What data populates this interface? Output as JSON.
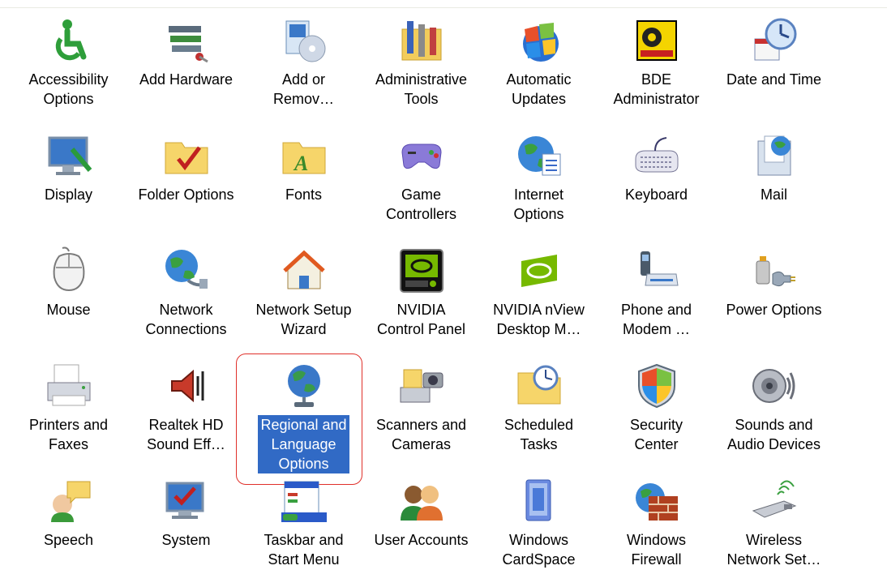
{
  "colors": {
    "selection": "#316ac5",
    "highlight_outline": "#e0302a"
  },
  "items": [
    {
      "label": "Accessibility\nOptions",
      "icon": "accessibility-icon"
    },
    {
      "label": "Add Hardware",
      "icon": "add-hardware-icon"
    },
    {
      "label": "Add or\nRemov…",
      "icon": "add-remove-programs-icon"
    },
    {
      "label": "Administrative\nTools",
      "icon": "administrative-tools-icon"
    },
    {
      "label": "Automatic\nUpdates",
      "icon": "automatic-updates-icon"
    },
    {
      "label": "BDE\nAdministrator",
      "icon": "bde-administrator-icon"
    },
    {
      "label": "Date and Time",
      "icon": "date-time-icon"
    },
    {
      "label": "Display",
      "icon": "display-icon"
    },
    {
      "label": "Folder Options",
      "icon": "folder-options-icon"
    },
    {
      "label": "Fonts",
      "icon": "fonts-icon"
    },
    {
      "label": "Game\nControllers",
      "icon": "game-controllers-icon"
    },
    {
      "label": "Internet\nOptions",
      "icon": "internet-options-icon"
    },
    {
      "label": "Keyboard",
      "icon": "keyboard-icon"
    },
    {
      "label": "Mail",
      "icon": "mail-icon"
    },
    {
      "label": "Mouse",
      "icon": "mouse-icon"
    },
    {
      "label": "Network\nConnections",
      "icon": "network-connections-icon"
    },
    {
      "label": "Network Setup\nWizard",
      "icon": "network-setup-wizard-icon"
    },
    {
      "label": "NVIDIA\nControl Panel",
      "icon": "nvidia-control-panel-icon"
    },
    {
      "label": "NVIDIA nView\nDesktop M…",
      "icon": "nvidia-nview-icon"
    },
    {
      "label": "Phone and\nModem …",
      "icon": "phone-modem-icon"
    },
    {
      "label": "Power Options",
      "icon": "power-options-icon"
    },
    {
      "label": "Printers and\nFaxes",
      "icon": "printers-faxes-icon"
    },
    {
      "label": "Realtek HD\nSound Eff…",
      "icon": "realtek-sound-icon"
    },
    {
      "label": "Regional and\nLanguage\nOptions",
      "icon": "regional-language-icon",
      "selected": true
    },
    {
      "label": "Scanners and\nCameras",
      "icon": "scanners-cameras-icon"
    },
    {
      "label": "Scheduled\nTasks",
      "icon": "scheduled-tasks-icon"
    },
    {
      "label": "Security\nCenter",
      "icon": "security-center-icon"
    },
    {
      "label": "Sounds and\nAudio Devices",
      "icon": "sounds-audio-icon"
    },
    {
      "label": "Speech",
      "icon": "speech-icon"
    },
    {
      "label": "System",
      "icon": "system-icon"
    },
    {
      "label": "Taskbar and\nStart Menu",
      "icon": "taskbar-start-menu-icon"
    },
    {
      "label": "User Accounts",
      "icon": "user-accounts-icon"
    },
    {
      "label": "Windows\nCardSpace",
      "icon": "windows-cardspace-icon"
    },
    {
      "label": "Windows\nFirewall",
      "icon": "windows-firewall-icon"
    },
    {
      "label": "Wireless\nNetwork Set…",
      "icon": "wireless-network-icon"
    }
  ]
}
